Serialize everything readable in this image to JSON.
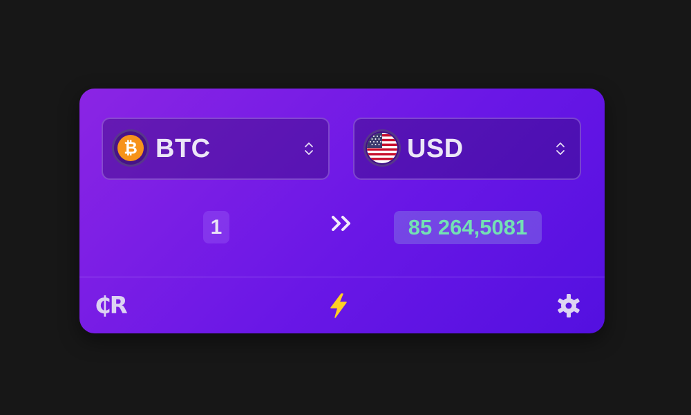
{
  "converter": {
    "from": {
      "code": "BTC",
      "icon": "bitcoin-icon",
      "symbol": "₿",
      "color": "#f7931a"
    },
    "to": {
      "code": "USD",
      "icon": "us-flag-icon"
    },
    "amount": "1",
    "result": "85 264,5081"
  },
  "footer": {
    "logo": "₵R",
    "center_icon": "lightning-bolt-icon",
    "right_icon": "gear-icon"
  },
  "colors": {
    "background": "#171717",
    "card_gradient_start": "#8b25e4",
    "card_gradient_end": "#5310e0",
    "result_text": "#74e0b4",
    "bolt": "#ffcf24"
  }
}
